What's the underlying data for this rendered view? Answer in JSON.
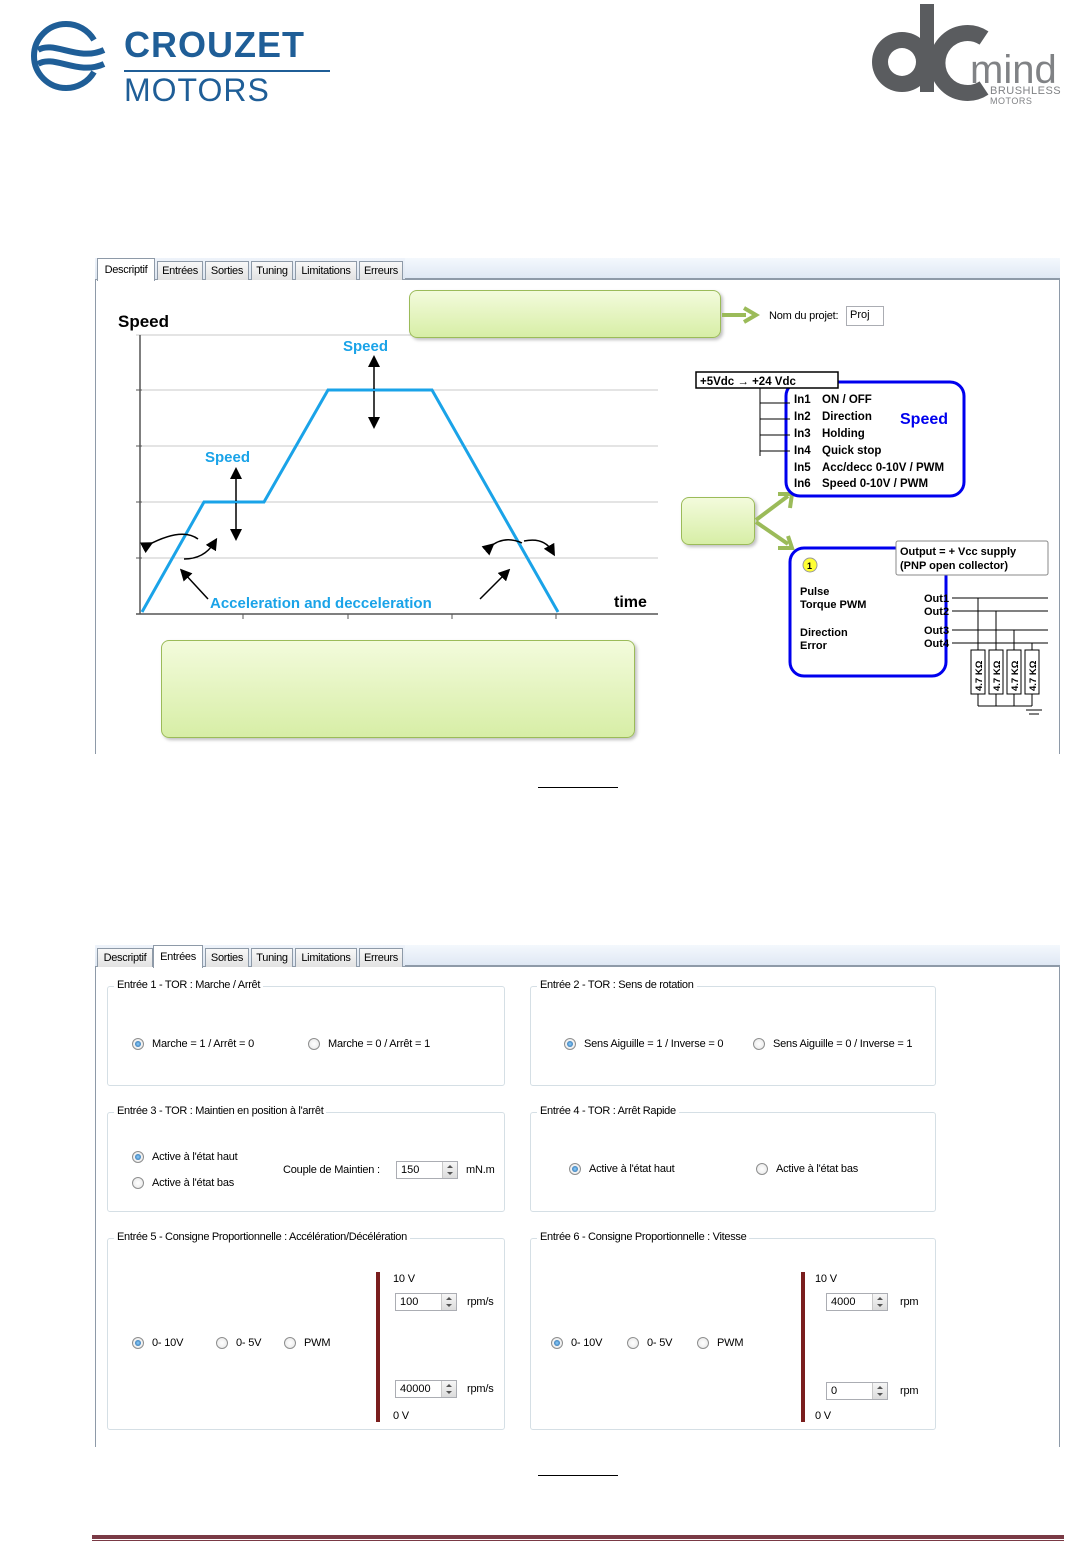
{
  "logos": {
    "left": {
      "brand": "CROUZET",
      "sub": "MOTORS"
    },
    "right": {
      "word": "mind",
      "tagline1": "BRUSHLESS",
      "tagline2": "MOTORS"
    }
  },
  "colors": {
    "brand_blue": "#1f5e97",
    "curve": "#1aa3e8",
    "diagram_blue": "#0000ee",
    "callout_green": "#9bbb59",
    "bar_red": "#7a1e1e"
  },
  "window1": {
    "tabs": [
      "Descriptif",
      "Entrées",
      "Sorties",
      "Tuning",
      "Limitations",
      "Erreurs"
    ],
    "active_tab": "Descriptif",
    "project_label": "Nom du projet:",
    "project_value": "Proj",
    "graph": {
      "ylabel": "Speed",
      "xlabel": "time",
      "speed_label_top": "Speed",
      "speed_label_mid": "Speed",
      "accel_label": "Acceleration and decceleration"
    },
    "inputs_box": {
      "supply": "+5Vdc  →  +24 Vdc",
      "title": "Speed",
      "lines": [
        {
          "pin": "In1",
          "fn": "ON / OFF"
        },
        {
          "pin": "In2",
          "fn": "Direction"
        },
        {
          "pin": "In3",
          "fn": "Holding"
        },
        {
          "pin": "In4",
          "fn": "Quick stop"
        },
        {
          "pin": "In5",
          "fn": "Acc/decc  0-10V / PWM"
        },
        {
          "pin": "In6",
          "fn": "Speed    0-10V / PWM"
        }
      ]
    },
    "outputs_box": {
      "note1": "Output = + Vcc supply",
      "note2": "(PNP open collector)",
      "badge": "1",
      "left_lines": [
        "Pulse",
        "Torque PWM",
        "",
        "Direction",
        "Error"
      ],
      "right_lines": [
        "Out1",
        "Out2",
        "Out3",
        "Out4"
      ],
      "resistor": "4.7 KΩ"
    }
  },
  "window2": {
    "tabs": [
      "Descriptif",
      "Entrées",
      "Sorties",
      "Tuning",
      "Limitations",
      "Erreurs"
    ],
    "active_tab": "Entrées",
    "g1": {
      "title": "Entrée 1 - TOR : Marche / Arrêt",
      "opt1": "Marche = 1 / Arrêt = 0",
      "opt2": "Marche = 0 / Arrêt = 1"
    },
    "g2": {
      "title": "Entrée 2 - TOR : Sens de rotation",
      "opt1": "Sens Aiguille = 1 / Inverse = 0",
      "opt2": "Sens Aiguille = 0 / Inverse = 1"
    },
    "g3": {
      "title": "Entrée 3 - TOR : Maintien en position à l'arrêt",
      "opt1": "Active à l'état haut",
      "opt2": "Active à l'état bas",
      "couple_label": "Couple de Maintien :",
      "couple_value": "150",
      "couple_unit": "mN.m"
    },
    "g4": {
      "title": "Entrée 4 - TOR : Arrêt Rapide",
      "opt1": "Active à l'état haut",
      "opt2": "Active à l'état bas"
    },
    "g5": {
      "title": "Entrée 5 - Consigne Proportionnelle : Accélération/Décélération",
      "opt1": "0- 10V",
      "opt2": "0- 5V",
      "opt3": "PWM",
      "top_label": "10 V",
      "top_value": "100",
      "top_unit": "rpm/s",
      "bottom_value": "40000",
      "bottom_unit": "rpm/s",
      "bottom_label": "0 V"
    },
    "g6": {
      "title": "Entrée 6 - Consigne Proportionnelle : Vitesse",
      "opt1": "0- 10V",
      "opt2": "0- 5V",
      "opt3": "PWM",
      "top_label": "10 V",
      "top_value": "4000",
      "top_unit": "rpm",
      "bottom_value": "0",
      "bottom_unit": "rpm",
      "bottom_label": "0 V"
    }
  }
}
